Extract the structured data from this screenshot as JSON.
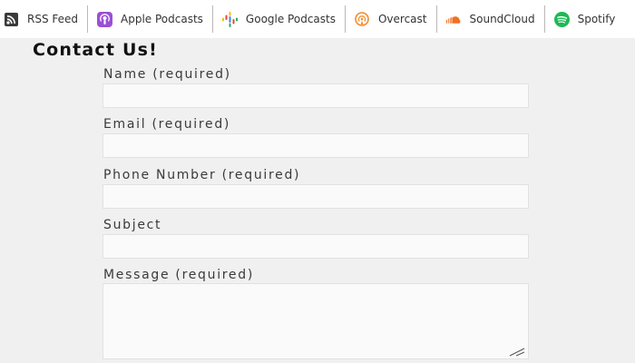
{
  "podcast_links": [
    {
      "label": "RSS Feed",
      "icon": "rss-icon",
      "color": "#3a3a3a"
    },
    {
      "label": "Apple Podcasts",
      "icon": "apple-podcasts-icon",
      "color": "#9b4fd6"
    },
    {
      "label": "Google Podcasts",
      "icon": "google-podcasts-icon",
      "color": "#4285f4"
    },
    {
      "label": "Overcast",
      "icon": "overcast-icon",
      "color": "#f28c28"
    },
    {
      "label": "SoundCloud",
      "icon": "soundcloud-icon",
      "color": "#f26f23"
    },
    {
      "label": "Spotify",
      "icon": "spotify-icon",
      "color": "#1db954"
    }
  ],
  "contact_form": {
    "title": "Contact Us!",
    "fields": [
      {
        "label": "Name (required)",
        "value": "",
        "type": "text"
      },
      {
        "label": "Email (required)",
        "value": "",
        "type": "email"
      },
      {
        "label": "Phone Number (required)",
        "value": "",
        "type": "tel"
      },
      {
        "label": "Subject",
        "value": "",
        "type": "text"
      },
      {
        "label": "Message (required)",
        "value": "",
        "type": "textarea"
      }
    ]
  }
}
